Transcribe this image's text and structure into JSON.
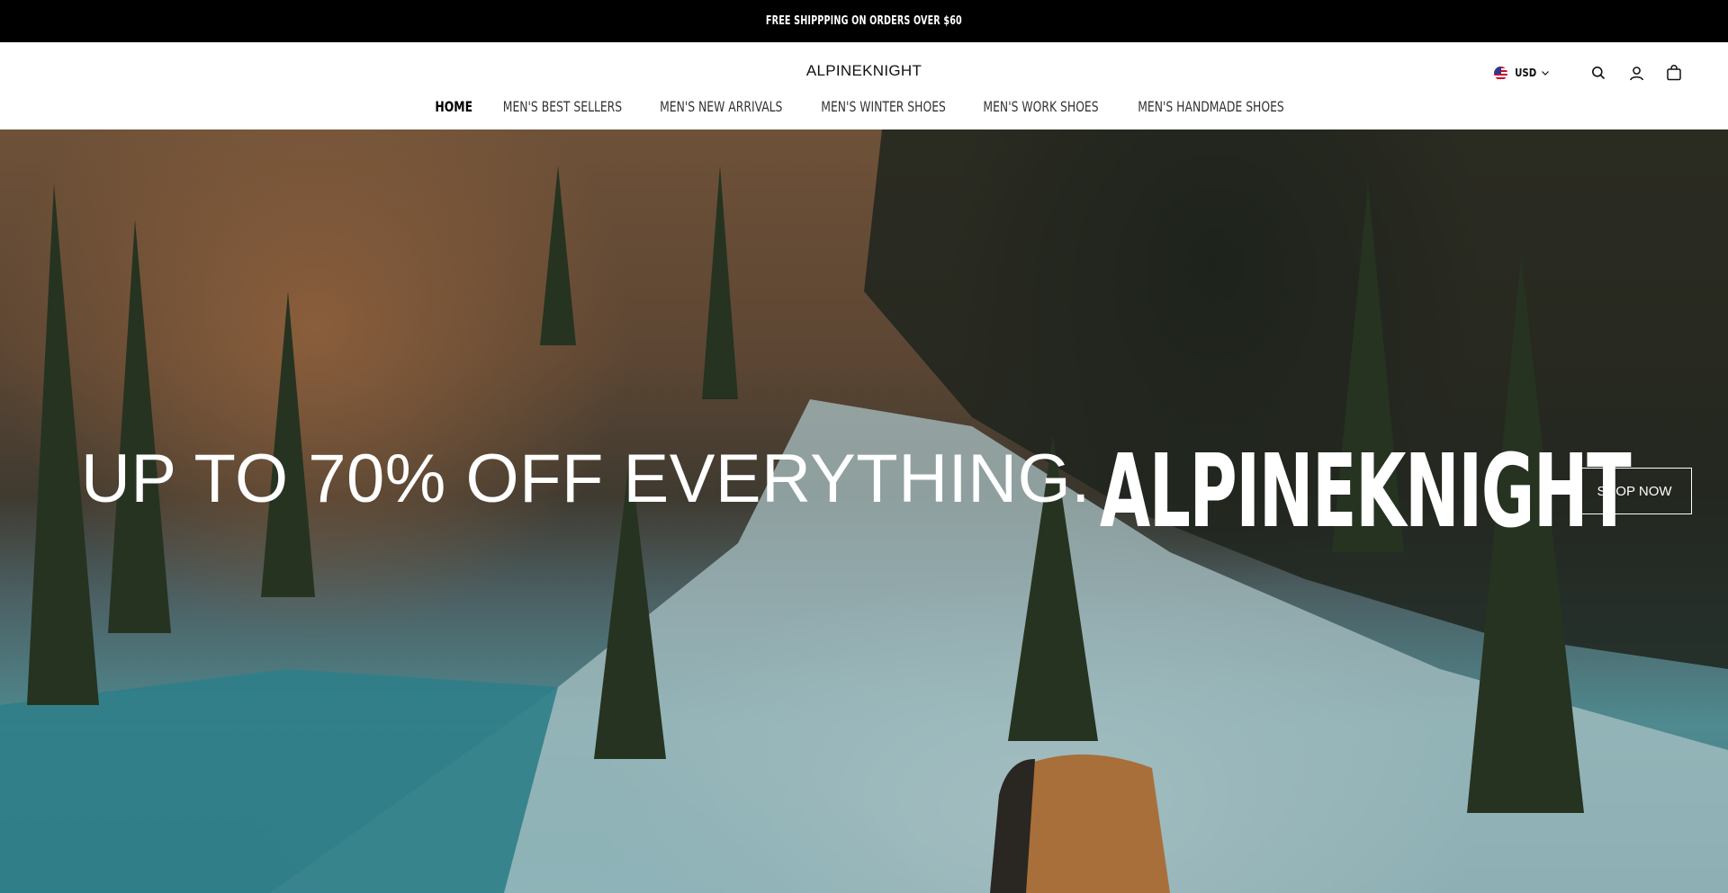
{
  "announcement": {
    "text": "FREE SHIPPPING ON ORDERS OVER $60"
  },
  "header": {
    "logo": "ALPINEKNIGHT",
    "currency": {
      "label": "USD",
      "flag_icon": "us-flag-icon"
    },
    "icons": [
      "search-icon",
      "account-icon",
      "cart-icon"
    ]
  },
  "nav": {
    "items": [
      {
        "label": "HOME",
        "active": true
      },
      {
        "label": "MEN'S BEST SELLERS"
      },
      {
        "label": "MEN'S NEW ARRIVALS"
      },
      {
        "label": "MEN'S WINTER SHOES"
      },
      {
        "label": "MEN'S WORK SHOES"
      },
      {
        "label": "MEN'S HANDMADE SHOES"
      }
    ]
  },
  "hero": {
    "headline": "UP TO 70% OFF EVERYTHING.",
    "brand": "ALPINEKNIGHT",
    "cta": "SHOP NOW"
  }
}
